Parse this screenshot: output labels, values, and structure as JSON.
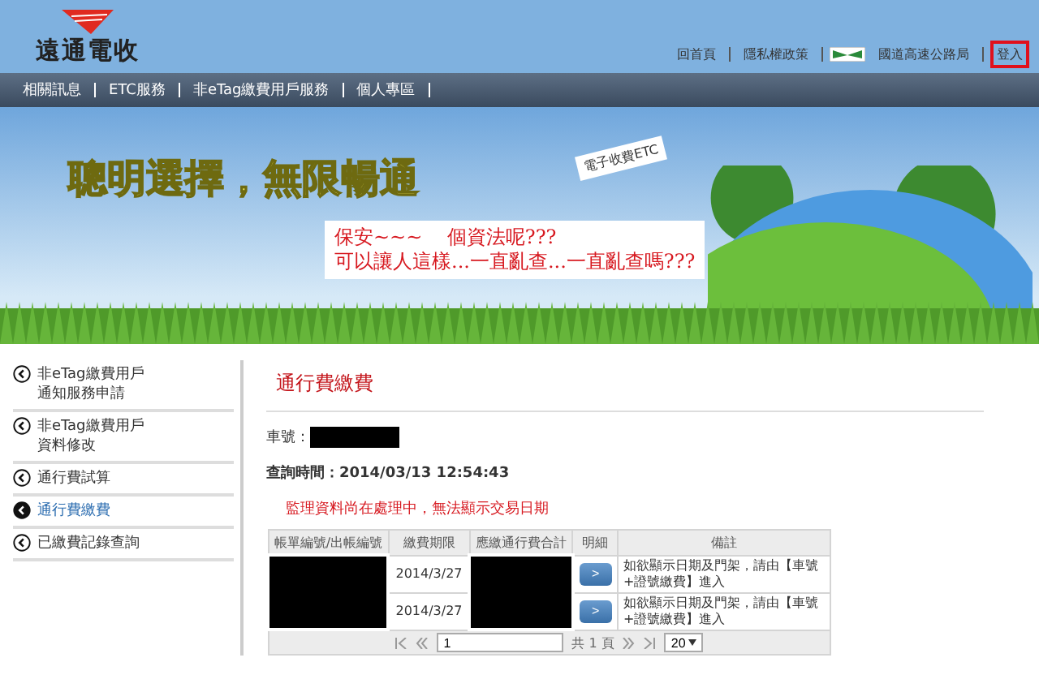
{
  "header": {
    "logo_text": "遠通電收",
    "top_links": [
      {
        "label": "回首頁",
        "kind": "text"
      },
      {
        "label": "隱私權政策",
        "kind": "text"
      },
      {
        "label": "國道高速公路局",
        "kind": "agency"
      },
      {
        "label": "登入",
        "kind": "login"
      }
    ]
  },
  "nav": [
    "相關訊息",
    "ETC服務",
    "非eTag繳費用戶服務",
    "個人專區"
  ],
  "banner": {
    "slogan": "聰明選擇，無限暢通",
    "sign": "電子收費ETC",
    "callout": [
      "保安~~~    個資法呢???",
      "可以讓人這樣...一直亂查...一直亂查嗎???"
    ]
  },
  "sidebar": [
    {
      "lines": [
        "非eTag繳費用戶",
        "通知服務申請"
      ],
      "selected": false
    },
    {
      "lines": [
        "非eTag繳費用戶",
        "資料修改"
      ],
      "selected": false
    },
    {
      "lines": [
        "通行費試算"
      ],
      "selected": false
    },
    {
      "lines": [
        "通行費繳費"
      ],
      "selected": true
    },
    {
      "lines": [
        "已繳費記錄查詢"
      ],
      "selected": false
    }
  ],
  "main": {
    "title": "通行費繳費",
    "plate_label": "車號：",
    "query_label": "查詢時間：",
    "query_time": "2014/03/13 12:54:43",
    "warning": "監理資料尚在處理中，無法顯示交易日期",
    "table": {
      "columns": [
        "帳單編號/出帳編號",
        "繳費期限",
        "應繳通行費合計",
        "明細",
        "備註"
      ],
      "rows": [
        {
          "due_date": "2014/3/27",
          "detail": ">",
          "remark": "如欲顯示日期及門架，請由【車號+證號繳費】進入"
        },
        {
          "due_date": "2014/3/27",
          "detail": ">",
          "remark": "如欲顯示日期及門架，請由【車號+證號繳費】進入"
        }
      ],
      "pager": {
        "page": "1",
        "total": "共 1 頁",
        "page_size": "20"
      }
    }
  }
}
